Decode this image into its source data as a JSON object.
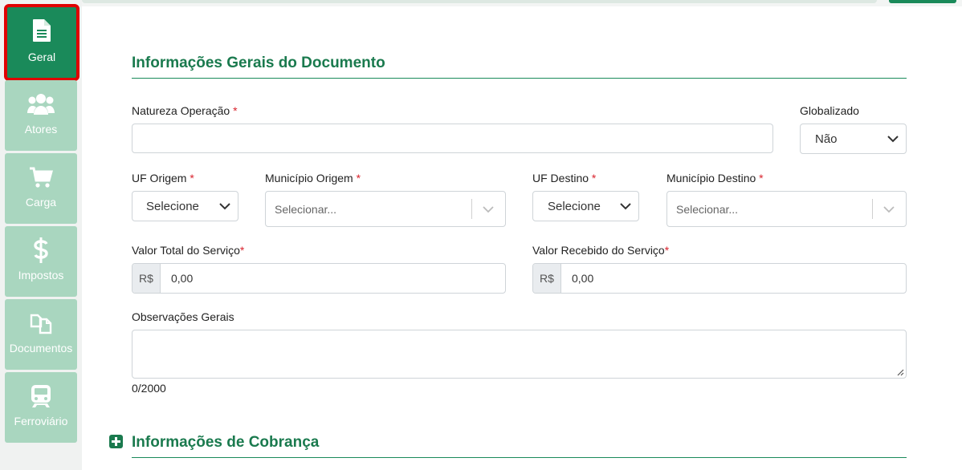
{
  "sidebar": {
    "items": [
      {
        "label": "Geral",
        "icon": "document-icon",
        "active": true
      },
      {
        "label": "Atores",
        "icon": "users-icon"
      },
      {
        "label": "Carga",
        "icon": "cart-icon"
      },
      {
        "label": "Impostos",
        "icon": "dollar-icon"
      },
      {
        "label": "Documentos",
        "icon": "documents-icon"
      },
      {
        "label": "Ferroviário",
        "icon": "train-icon"
      }
    ]
  },
  "general": {
    "title": "Informações Gerais do Documento",
    "natureza": {
      "label": "Natureza Operação",
      "required": "*",
      "value": ""
    },
    "globalizado": {
      "label": "Globalizado",
      "value": "Não"
    },
    "uf_origem": {
      "label": "UF Origem",
      "required": "*",
      "value": "Selecione"
    },
    "municipio_origem": {
      "label": "Município Origem",
      "required": "*",
      "placeholder": "Selecionar..."
    },
    "uf_destino": {
      "label": "UF Destino",
      "required": "*",
      "value": "Selecione"
    },
    "municipio_destino": {
      "label": "Município Destino",
      "required": "*",
      "placeholder": "Selecionar..."
    },
    "valor_total": {
      "label": "Valor Total do Serviço",
      "required": "*",
      "prefix": "R$",
      "value": "0,00"
    },
    "valor_recebido": {
      "label": "Valor Recebido do Serviço",
      "required": "*",
      "prefix": "R$",
      "value": "0,00"
    },
    "observacoes": {
      "label": "Observações Gerais",
      "value": "",
      "counter": "0/2000"
    }
  },
  "cobranca": {
    "title": "Informações de Cobrança"
  },
  "colors": {
    "accent": "#1a8a5a",
    "sidebar_inactive": "#a9d6bf",
    "required": "#d9232d"
  }
}
